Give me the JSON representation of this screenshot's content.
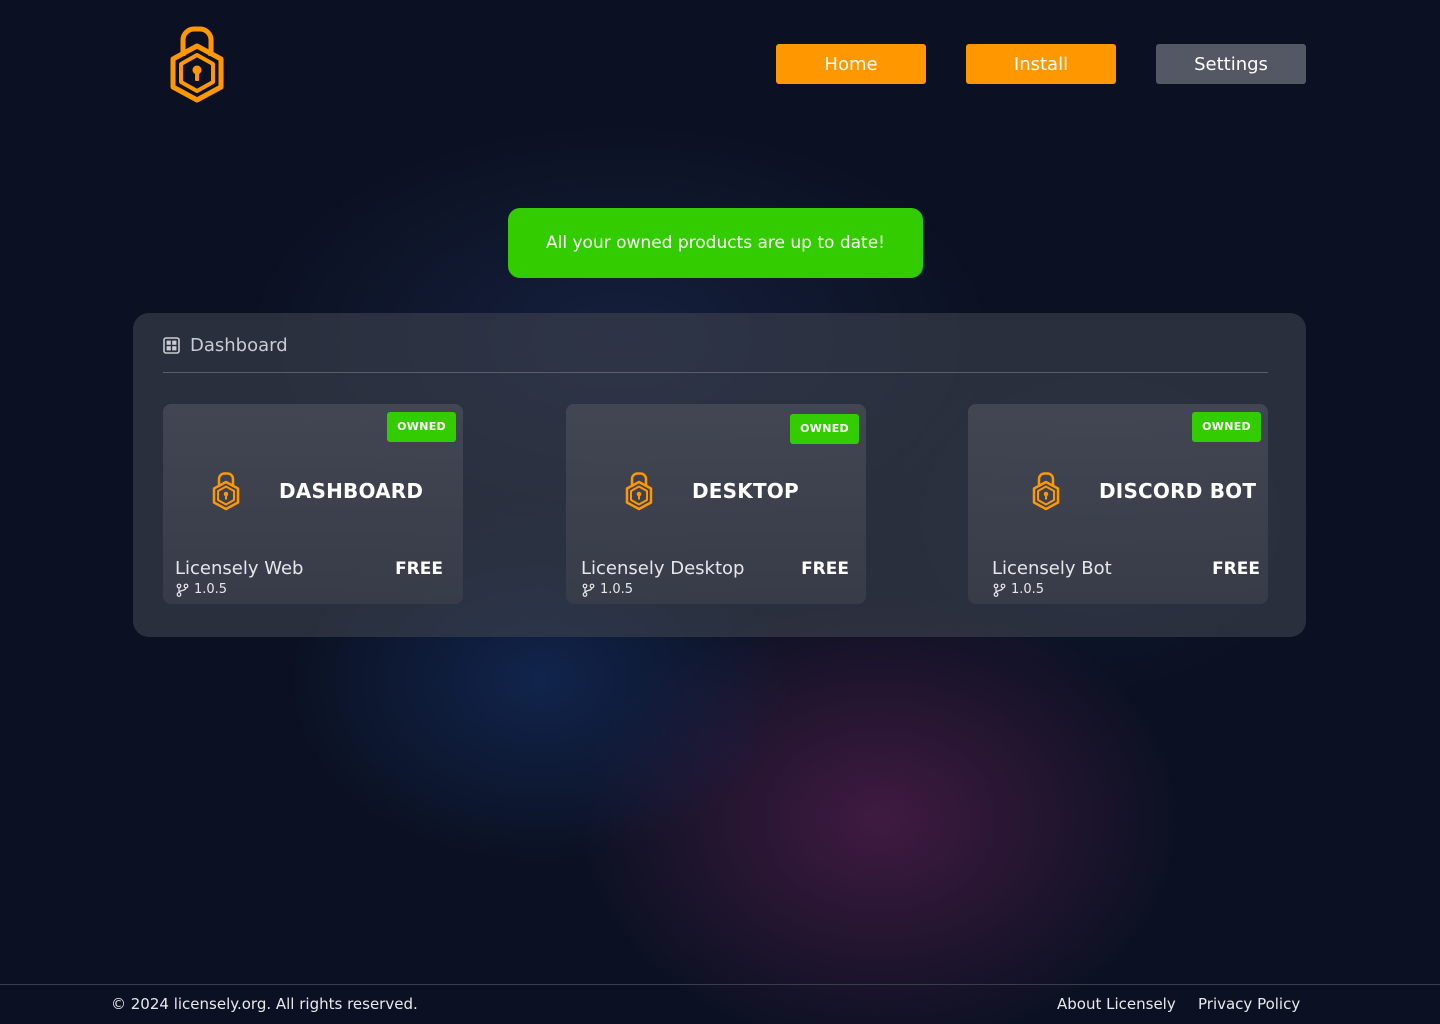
{
  "brand": {
    "logo_icon": "shield-lock-icon",
    "accent": "#ff9800"
  },
  "nav": {
    "home_label": "Home",
    "install_label": "Install",
    "settings_label": "Settings"
  },
  "banner": {
    "message": "All your owned products are up to date!",
    "color": "#33cc00"
  },
  "dashboard": {
    "heading": "Dashboard",
    "heading_icon": "grid-icon",
    "products": [
      {
        "badge": "OWNED",
        "title": "DASHBOARD",
        "name": "Licensely Web",
        "price": "FREE",
        "version": "1.0.5"
      },
      {
        "badge": "OWNED",
        "title": "DESKTOP",
        "name": "Licensely Desktop",
        "price": "FREE",
        "version": "1.0.5"
      },
      {
        "badge": "OWNED",
        "title": "DISCORD BOT",
        "name": "Licensely Bot",
        "price": "FREE",
        "version": "1.0.5"
      }
    ]
  },
  "footer": {
    "copyright": "© 2024 licensely.org. All rights reserved.",
    "about_label": "About Licensely",
    "privacy_label": "Privacy Policy"
  }
}
